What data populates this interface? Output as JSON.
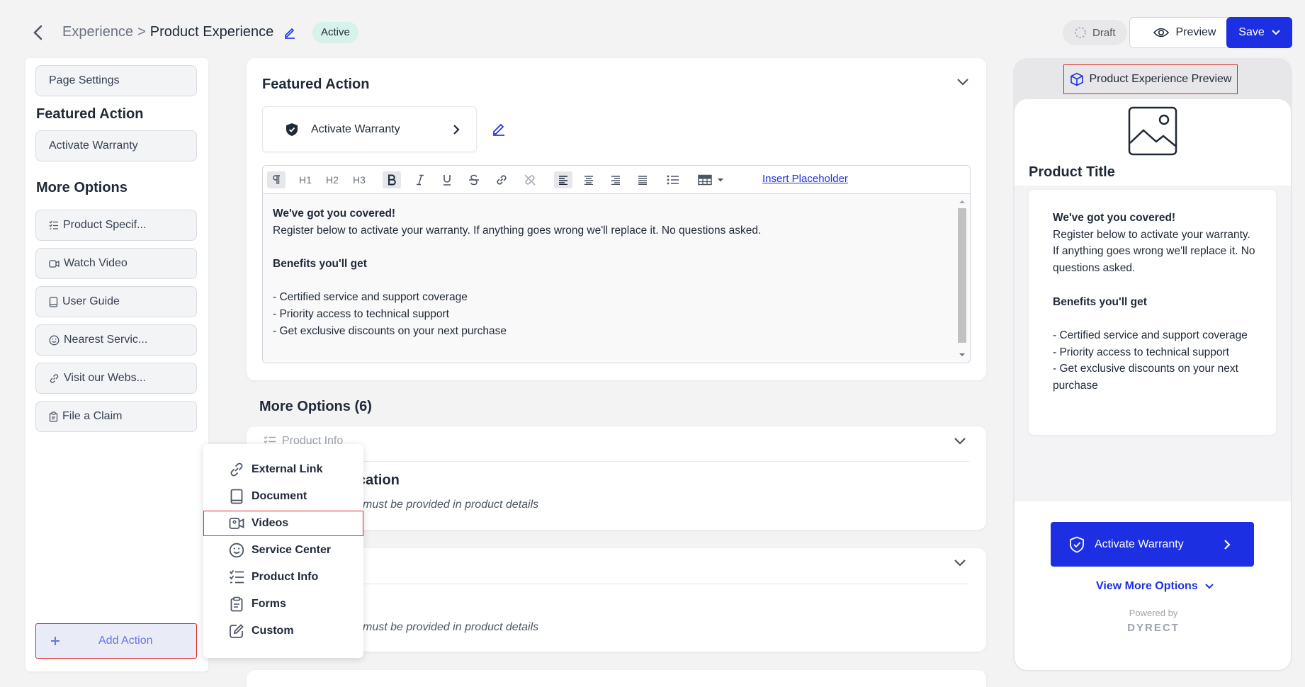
{
  "header": {
    "breadcrumb_parent": "Experience",
    "breadcrumb_sep": ">",
    "breadcrumb_current": "Product Experience",
    "status_badge": "Active",
    "draft_label": "Draft",
    "preview_label": "Preview",
    "save_label": "Save"
  },
  "sidebar": {
    "page_settings": "Page Settings",
    "featured_heading": "Featured Action",
    "featured_item": "Activate Warranty",
    "more_heading": "More Options",
    "items": [
      {
        "label": "Product Specif...",
        "icon": "list-check-icon"
      },
      {
        "label": "Watch Video",
        "icon": "video-icon"
      },
      {
        "label": "User Guide",
        "icon": "book-icon"
      },
      {
        "label": "Nearest Servic...",
        "icon": "smiley-icon"
      },
      {
        "label": "Visit our Webs...",
        "icon": "link-icon"
      },
      {
        "label": "File a Claim",
        "icon": "clipboard-icon"
      }
    ],
    "add_action": "Add Action"
  },
  "featured": {
    "title": "Featured Action",
    "action_label": "Activate Warranty",
    "insert_placeholder": "Insert Placeholder",
    "toolbar": {
      "h1": "H1",
      "h2": "H2",
      "h3": "H3"
    },
    "body": {
      "heading": "We've got you covered!",
      "line1": "Register below to activate your warranty. If anything goes wrong we'll replace it. No questions asked.",
      "benefits_heading": "Benefits you'll get",
      "benefits": [
        "- Certified service and support coverage",
        "- Priority access to technical support",
        "- Get exclusive discounts on your next purchase"
      ]
    }
  },
  "more_options": {
    "title": "More Options (6)",
    "card1_head": "Product Info",
    "card1_title": "cation",
    "card1_note": "must be provided in product details",
    "card2_note": "must be provided in product details"
  },
  "dropdown": {
    "items": [
      {
        "label": "External Link",
        "icon": "link-icon"
      },
      {
        "label": "Document",
        "icon": "book-icon"
      },
      {
        "label": "Videos",
        "icon": "video-icon"
      },
      {
        "label": "Service Center",
        "icon": "smiley-icon"
      },
      {
        "label": "Product Info",
        "icon": "list-check-icon"
      },
      {
        "label": "Forms",
        "icon": "clipboard-icon"
      },
      {
        "label": "Custom",
        "icon": "pencil-square-icon"
      }
    ]
  },
  "preview": {
    "header": "Product Experience Preview",
    "product_title": "Product Title",
    "heading": "We've got you covered!",
    "line1": "Register below to activate your warranty. If anything goes wrong we'll replace it. No questions asked.",
    "benefits_heading": "Benefits you'll get",
    "benefits": [
      "- Certified service and support coverage",
      "- Priority access to technical support",
      "- Get exclusive discounts on your next purchase"
    ],
    "button_label": "Activate Warranty",
    "view_more": "View More Options",
    "powered_by": "Powered by",
    "brand": "DYRECT"
  },
  "colors": {
    "primary": "#1d2fe3",
    "active_badge_bg": "#d7f2ea",
    "highlight_border": "#e02424"
  }
}
